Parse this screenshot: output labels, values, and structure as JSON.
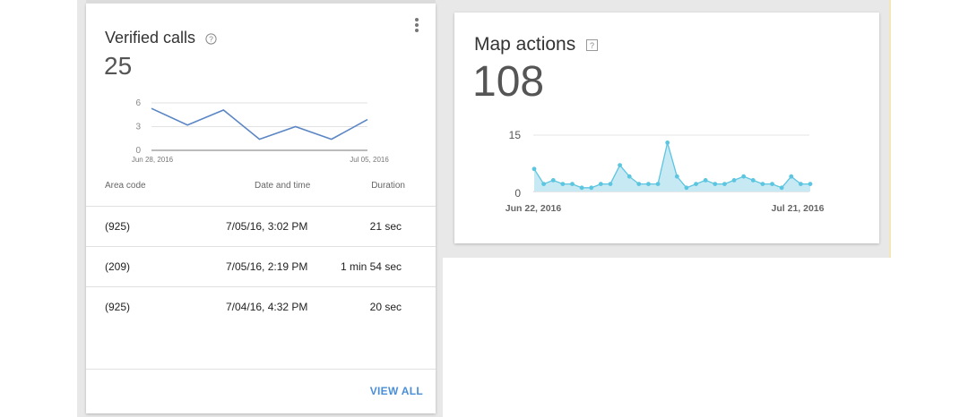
{
  "verified_calls": {
    "title": "Verified calls",
    "total": "25",
    "table": {
      "headers": [
        "Area code",
        "Date and time",
        "Duration"
      ],
      "rows": [
        {
          "area": "(925)",
          "datetime": "7/05/16, 3:02 PM",
          "duration": "21 sec"
        },
        {
          "area": "(209)",
          "datetime": "7/05/16, 2:19 PM",
          "duration": "1 min 54 sec"
        },
        {
          "area": "(925)",
          "datetime": "7/04/16, 4:32 PM",
          "duration": "20 sec"
        }
      ]
    },
    "view_all_label": "VIEW ALL"
  },
  "map_actions": {
    "title": "Map actions",
    "total": "108"
  },
  "colors": {
    "calls_line": "#5b86c4",
    "map_line": "#5cc5e0",
    "map_fill": "#c6e9f3",
    "link": "#4a8fd6"
  },
  "chart_data": [
    {
      "type": "line",
      "x_tick_labels": [
        "Jun 28, 2016",
        "Jul 05, 2016"
      ],
      "y_ticks": [
        0,
        3,
        6
      ],
      "ylim": [
        0,
        6
      ],
      "values": [
        5.3,
        3.2,
        5.1,
        1.4,
        3.0,
        1.4,
        3.9
      ],
      "grid": true
    },
    {
      "type": "area",
      "x_tick_labels": [
        "Jun 22, 2016",
        "Jul 21, 2016"
      ],
      "y_ticks": [
        0,
        15
      ],
      "ylim": [
        0,
        15
      ],
      "values": [
        6,
        2,
        3,
        2,
        2,
        1,
        1,
        2,
        2,
        7,
        4,
        2,
        2,
        2,
        13,
        4,
        1,
        2,
        3,
        2,
        2,
        3,
        4,
        3,
        2,
        2,
        1,
        4,
        2,
        2
      ],
      "grid": true
    }
  ]
}
